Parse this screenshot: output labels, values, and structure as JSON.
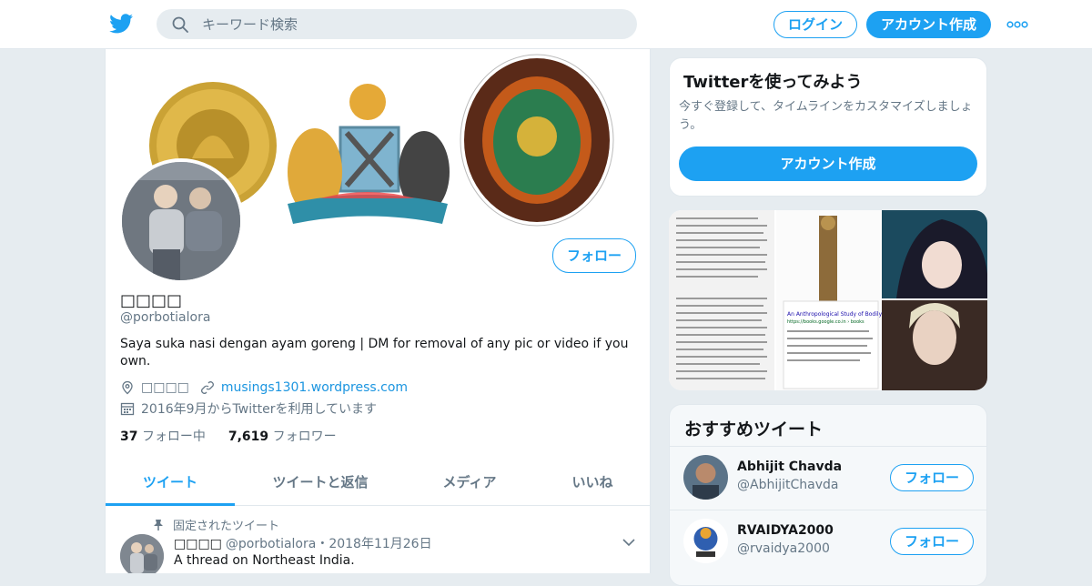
{
  "header": {
    "search_placeholder": "キーワード検索",
    "login_label": "ログイン",
    "signup_label": "アカウント作成"
  },
  "profile": {
    "name": "□□□□",
    "handle": "@porbotialora",
    "bio": "Saya suka nasi dengan ayam goreng | DM for removal of any pic or video if you own.",
    "location": "□□□□",
    "website": "musings1301.wordpress.com",
    "joined": "2016年9月からTwitterを利用しています",
    "following_count": "37",
    "following_label": "フォロー中",
    "followers_count": "7,619",
    "followers_label": "フォロワー",
    "follow_label": "フォロー"
  },
  "tabs": [
    {
      "label": "ツイート"
    },
    {
      "label": "ツイートと返信"
    },
    {
      "label": "メディア"
    },
    {
      "label": "いいね"
    }
  ],
  "pinned_tweet": {
    "pinned_label": "固定されたツイート",
    "name": "□□□□",
    "handle_date": "@porbotialora・2018年11月26日",
    "text": "A thread on Northeast India."
  },
  "sidebar": {
    "try_title": "Twitterを使ってみよう",
    "try_text": "今すぐ登録して、タイムラインをカスタマイズしましょう。",
    "try_button": "アカウント作成",
    "media_caption": "An Anthropological Study of Bodily Height of Indian Population - Page 2",
    "media_caption_link": "https://books.google.co.in › books",
    "recommended_title": "おすすめツイート",
    "recommended": [
      {
        "name": "Abhijit Chavda",
        "handle": "@AbhijitChavda",
        "follow": "フォロー"
      },
      {
        "name": "RVAIDYA2000",
        "handle": "@rvaidya2000",
        "follow": "フォロー"
      }
    ]
  },
  "colors": {
    "accent": "#1da1f2",
    "background": "#e6ecf0",
    "text_muted": "#657786"
  },
  "icons": [
    "twitter-bird-icon",
    "search-icon",
    "more-icon",
    "location-icon",
    "link-icon",
    "calendar-icon",
    "pin-icon",
    "chevron-down-icon"
  ]
}
